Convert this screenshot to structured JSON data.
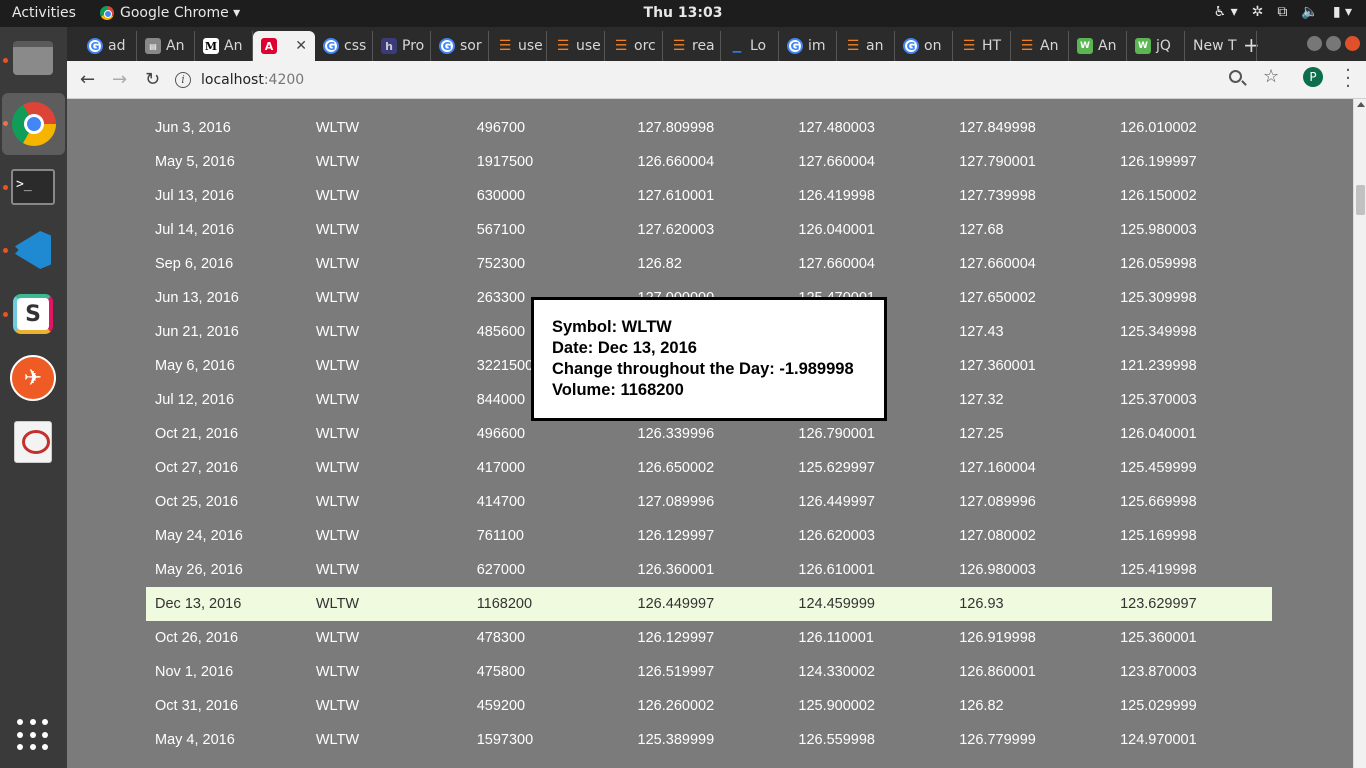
{
  "topbar": {
    "activities": "Activities",
    "app_name": "Google Chrome ▾",
    "clock": "Thu 13:03"
  },
  "browser": {
    "tabs": [
      {
        "icon": "google-icon",
        "label": "ad"
      },
      {
        "icon": "generic-page-icon",
        "label": "An"
      },
      {
        "icon": "medium-icon",
        "label": "An"
      },
      {
        "icon": "angular-icon",
        "label": "",
        "active": true
      },
      {
        "icon": "google-icon",
        "label": "css"
      },
      {
        "icon": "h-icon",
        "label": "Pro"
      },
      {
        "icon": "google-icon",
        "label": "sor"
      },
      {
        "icon": "stackoverflow-icon",
        "label": "use"
      },
      {
        "icon": "stackoverflow-icon",
        "label": "use"
      },
      {
        "icon": "stackoverflow-icon",
        "label": "orc"
      },
      {
        "icon": "stackoverflow-icon",
        "label": "rea"
      },
      {
        "icon": "blue-page-icon",
        "label": "Lo"
      },
      {
        "icon": "google-icon",
        "label": "im"
      },
      {
        "icon": "stackoverflow-icon",
        "label": "an"
      },
      {
        "icon": "google-icon",
        "label": "on"
      },
      {
        "icon": "stackoverflow-icon",
        "label": "HT"
      },
      {
        "icon": "stackoverflow-icon",
        "label": "An"
      },
      {
        "icon": "webflow-icon",
        "label": "An"
      },
      {
        "icon": "webflow-icon",
        "label": "jQ"
      },
      {
        "icon": "",
        "label": "New T"
      }
    ],
    "url_host": "localhost",
    "url_port": ":4200",
    "profile_initial": "P"
  },
  "table": {
    "partial_row": "...",
    "selected_index": 14,
    "rows": [
      [
        "Jun 3, 2016",
        "WLTW",
        "496700",
        "127.809998",
        "127.480003",
        "127.849998",
        "126.010002"
      ],
      [
        "May 5, 2016",
        "WLTW",
        "1917500",
        "126.660004",
        "127.660004",
        "127.790001",
        "126.199997"
      ],
      [
        "Jul 13, 2016",
        "WLTW",
        "630000",
        "127.610001",
        "126.419998",
        "127.739998",
        "126.150002"
      ],
      [
        "Jul 14, 2016",
        "WLTW",
        "567100",
        "127.620003",
        "126.040001",
        "127.68",
        "125.980003"
      ],
      [
        "Sep 6, 2016",
        "WLTW",
        "752300",
        "126.82",
        "127.660004",
        "127.660004",
        "126.059998"
      ],
      [
        "Jun 13, 2016",
        "WLTW",
        "263300",
        "127.000000",
        "125.470001",
        "127.650002",
        "125.309998"
      ],
      [
        "Jun 21, 2016",
        "WLTW",
        "485600",
        "",
        "",
        "127.43",
        "125.349998"
      ],
      [
        "May 6, 2016",
        "WLTW",
        "3221500",
        "",
        "",
        "127.360001",
        "121.239998"
      ],
      [
        "Jul 12, 2016",
        "WLTW",
        "844000",
        "",
        "",
        "127.32",
        "125.370003"
      ],
      [
        "Oct 21, 2016",
        "WLTW",
        "496600",
        "126.339996",
        "126.790001",
        "127.25",
        "126.040001"
      ],
      [
        "Oct 27, 2016",
        "WLTW",
        "417000",
        "126.650002",
        "125.629997",
        "127.160004",
        "125.459999"
      ],
      [
        "Oct 25, 2016",
        "WLTW",
        "414700",
        "127.089996",
        "126.449997",
        "127.089996",
        "125.669998"
      ],
      [
        "May 24, 2016",
        "WLTW",
        "761100",
        "126.129997",
        "126.620003",
        "127.080002",
        "125.169998"
      ],
      [
        "May 26, 2016",
        "WLTW",
        "627000",
        "126.360001",
        "126.610001",
        "126.980003",
        "125.419998"
      ],
      [
        "Dec 13, 2016",
        "WLTW",
        "1168200",
        "126.449997",
        "124.459999",
        "126.93",
        "123.629997"
      ],
      [
        "Oct 26, 2016",
        "WLTW",
        "478300",
        "126.129997",
        "126.110001",
        "126.919998",
        "125.360001"
      ],
      [
        "Nov 1, 2016",
        "WLTW",
        "475800",
        "126.519997",
        "124.330002",
        "126.860001",
        "123.870003"
      ],
      [
        "Oct 31, 2016",
        "WLTW",
        "459200",
        "126.260002",
        "125.900002",
        "126.82",
        "125.029999"
      ],
      [
        "May 4, 2016",
        "WLTW",
        "1597300",
        "125.389999",
        "126.559998",
        "126.779999",
        "124.970001"
      ]
    ]
  },
  "tooltip": {
    "symbol": "Symbol: WLTW",
    "date": "Date: Dec 13, 2016",
    "change": "Change throughout the Day: -1.989998",
    "volume": "Volume: 1168200"
  },
  "colors": {
    "page_background": "#7b7b7b",
    "selected_row": "#f0fadf"
  }
}
